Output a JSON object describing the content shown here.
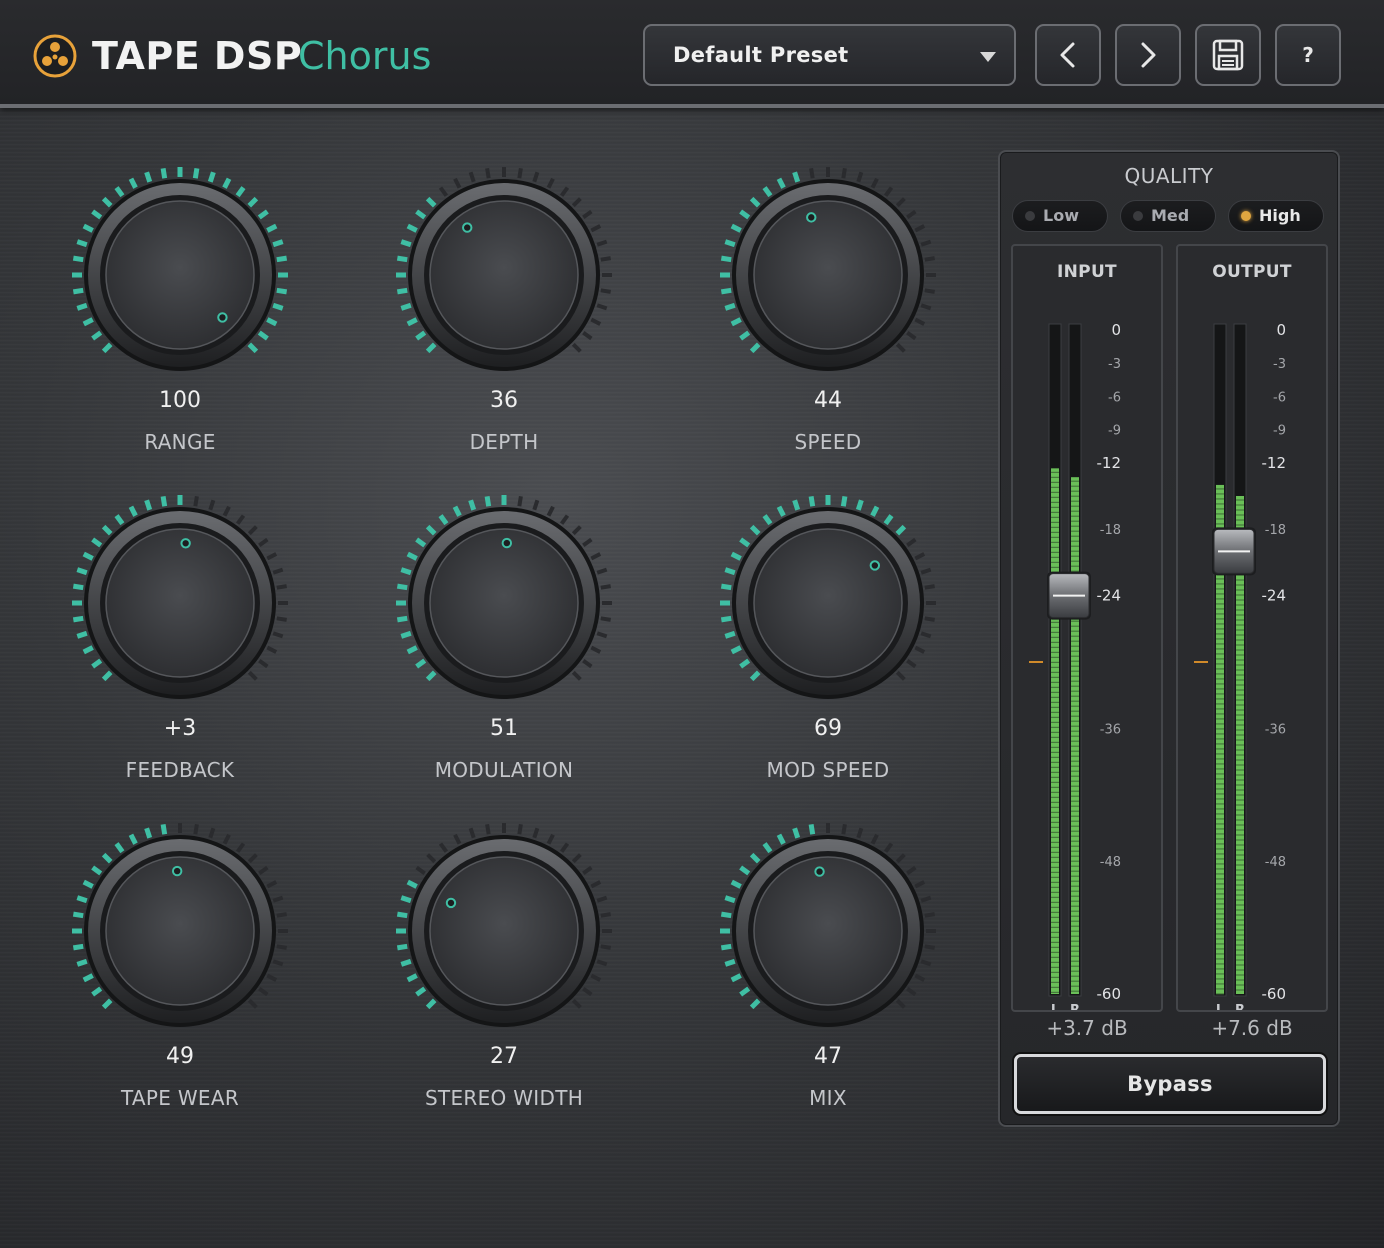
{
  "header": {
    "app_name": "TAPE DSP",
    "plugin_name": "Chorus",
    "logo_icon": "tape-reel-icon",
    "preset": {
      "selected": "Default Preset"
    },
    "buttons": {
      "prev_icon": "chevron-left-icon",
      "next_icon": "chevron-right-icon",
      "save_icon": "floppy-disk-icon",
      "help_label": "?"
    }
  },
  "knobs": [
    {
      "value": "100",
      "label": "RANGE",
      "level": 1.0
    },
    {
      "value": "36",
      "label": "DEPTH",
      "level": 0.36
    },
    {
      "value": "44",
      "label": "SPEED",
      "level": 0.44
    },
    {
      "value": "+3",
      "label": "FEEDBACK",
      "level": 0.52
    },
    {
      "value": "51",
      "label": "MODULATION",
      "level": 0.51
    },
    {
      "value": "69",
      "label": "MOD SPEED",
      "level": 0.69
    },
    {
      "value": "49",
      "label": "TAPE WEAR",
      "level": 0.49
    },
    {
      "value": "27",
      "label": "STEREO WIDTH",
      "level": 0.27
    },
    {
      "value": "47",
      "label": "MIX",
      "level": 0.47
    }
  ],
  "quality": {
    "title": "QUALITY",
    "options": [
      "Low",
      "Med",
      "High"
    ],
    "selected": "High"
  },
  "meters": {
    "scale_ticks": [
      "0",
      "-3",
      "-6",
      "-9",
      "-12",
      "-18",
      "-24",
      "-36",
      "-48",
      "-60"
    ],
    "channel_labels": [
      "L",
      "R"
    ],
    "input": {
      "title": "INPUT",
      "gain": "+3.7 dB",
      "level_L_db": -12.5,
      "level_R_db": -13.3,
      "fader_db": -24
    },
    "output": {
      "title": "OUTPUT",
      "gain": "+7.6 dB",
      "level_L_db": -14.0,
      "level_R_db": -15.0,
      "fader_db": -20
    }
  },
  "bypass": {
    "label": "Bypass"
  },
  "colors": {
    "accent": "#3fbfa4",
    "led_active": "#e0a640",
    "meter_green": "#6abf58",
    "unity_marker": "#d08a2a"
  }
}
